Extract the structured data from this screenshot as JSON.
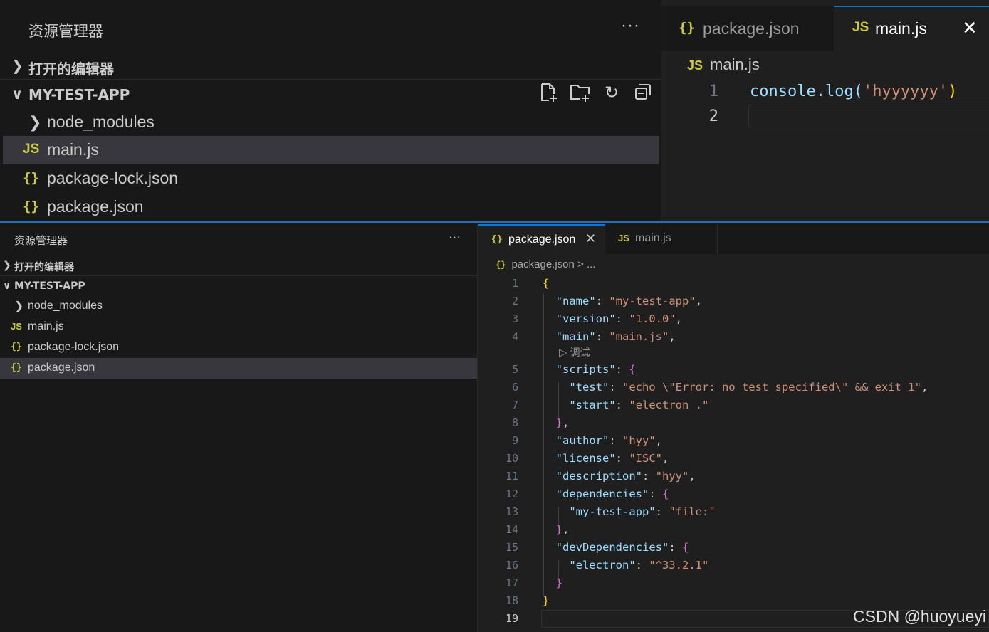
{
  "top": {
    "explorer": {
      "title": "资源管理器",
      "more": "···",
      "open_editors": "打开的编辑器",
      "project": "MY-TEST-APP",
      "items": [
        {
          "label": "node_modules",
          "icon": "chevron-right-icon"
        },
        {
          "label": "main.js",
          "icon": "JS"
        },
        {
          "label": "package-lock.json",
          "icon": "{}"
        },
        {
          "label": "package.json",
          "icon": "{}"
        }
      ]
    },
    "tabs": [
      {
        "label": "package.json",
        "icon": "{}"
      },
      {
        "label": "main.js",
        "icon": "JS"
      }
    ],
    "close": "✕",
    "breadcrumb": "main.js",
    "breadcrumb_icon": "JS",
    "code_lines": [
      {
        "num": "1",
        "code_fn": "console.log(",
        "code_str": "'hyyyyyy'",
        "code_end": ")"
      },
      {
        "num": "2"
      }
    ]
  },
  "bottom": {
    "explorer": {
      "title": "资源管理器",
      "more": "···",
      "open_editors": "打开的编辑器",
      "project": "MY-TEST-APP",
      "items": [
        {
          "label": "node_modules",
          "icon": "chevron-right-icon"
        },
        {
          "label": "main.js",
          "icon": "JS"
        },
        {
          "label": "package-lock.json",
          "icon": "{}"
        },
        {
          "label": "package.json",
          "icon": "{}"
        }
      ]
    },
    "tabs": [
      {
        "label": "package.json",
        "icon": "{}"
      },
      {
        "label": "main.js",
        "icon": "JS"
      }
    ],
    "close": "✕",
    "breadcrumb": "package.json",
    "breadcrumb_sep": ">",
    "breadcrumb_more": "...",
    "breadcrumb_icon": "{}",
    "codelens": "调试",
    "lines": {
      "l1": "1",
      "l2": "2",
      "l3": "3",
      "l4": "4",
      "l5": "5",
      "l6": "6",
      "l7": "7",
      "l8": "8",
      "l9": "9",
      "l10": "10",
      "l11": "11",
      "l12": "12",
      "l13": "13",
      "l14": "14",
      "l15": "15",
      "l16": "16",
      "l17": "17",
      "l18": "18",
      "l19": "19"
    },
    "json": {
      "name_key": "\"name\"",
      "name_val": "\"my-test-app\"",
      "version_key": "\"version\"",
      "version_val": "\"1.0.0\"",
      "main_key": "\"main\"",
      "main_val": "\"main.js\"",
      "scripts_key": "\"scripts\"",
      "test_key": "\"test\"",
      "test_val": "\"echo \\\"Error: no test specified\\\" && exit 1\"",
      "start_key": "\"start\"",
      "start_val": "\"electron .\"",
      "author_key": "\"author\"",
      "author_val": "\"hyy\"",
      "license_key": "\"license\"",
      "license_val": "\"ISC\"",
      "description_key": "\"description\"",
      "description_val": "\"hyy\"",
      "dependencies_key": "\"dependencies\"",
      "mta_key": "\"my-test-app\"",
      "mta_val": "\"file:\"",
      "devdeps_key": "\"devDependencies\"",
      "electron_key": "\"electron\"",
      "electron_val": "\"^33.2.1\""
    }
  },
  "watermark": "CSDN @huoyueyi"
}
